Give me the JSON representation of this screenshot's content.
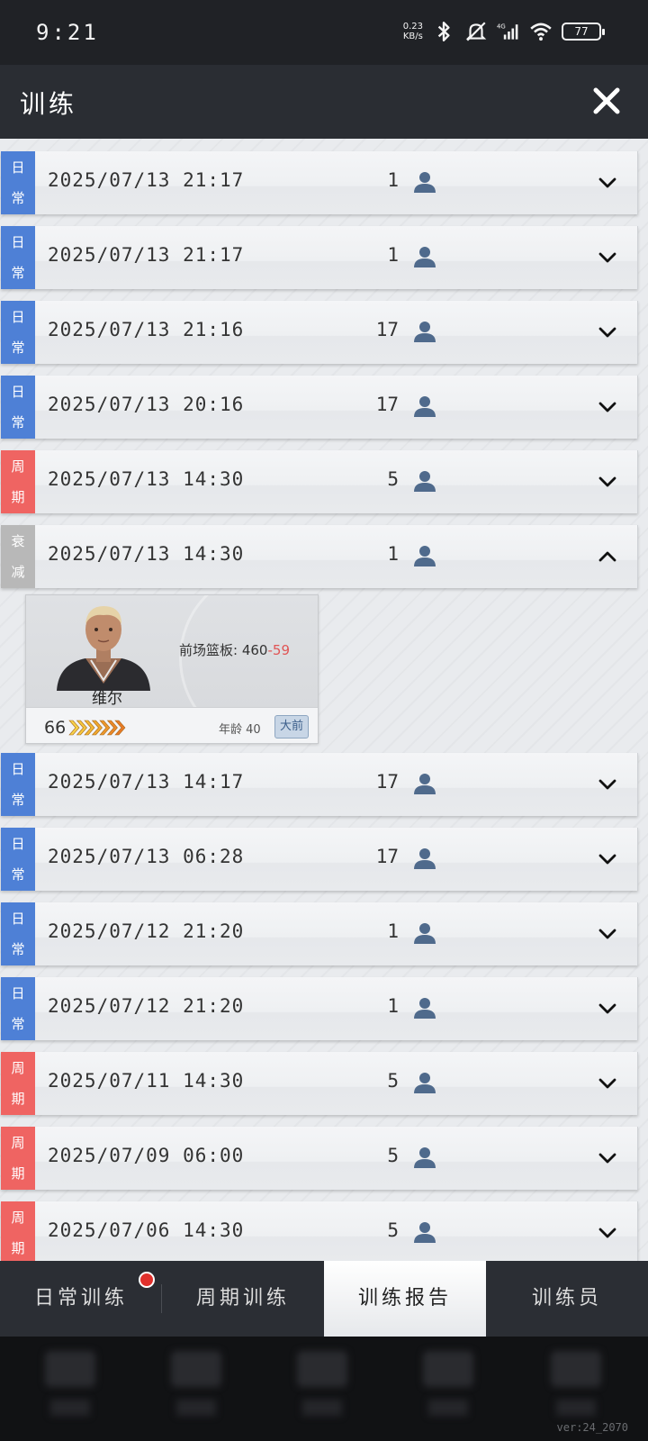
{
  "status_bar": {
    "time": "9:21",
    "net_speed": "0.23",
    "net_unit": "KB/s",
    "signal_label": "4G",
    "battery": "77"
  },
  "header": {
    "title": "训练"
  },
  "tags": {
    "daily": [
      "日",
      "常"
    ],
    "weekly": [
      "周",
      "期"
    ],
    "decline": [
      "衰",
      "减"
    ]
  },
  "rows": [
    {
      "type": "daily",
      "date": "2025/07/13 21:17",
      "count": "1",
      "expanded": false
    },
    {
      "type": "daily",
      "date": "2025/07/13 21:17",
      "count": "1",
      "expanded": false
    },
    {
      "type": "daily",
      "date": "2025/07/13 21:16",
      "count": "17",
      "expanded": false
    },
    {
      "type": "daily",
      "date": "2025/07/13 20:16",
      "count": "17",
      "expanded": false
    },
    {
      "type": "weekly",
      "date": "2025/07/13 14:30",
      "count": "5",
      "expanded": false
    },
    {
      "type": "decline",
      "date": "2025/07/13 14:30",
      "count": "1",
      "expanded": true
    },
    {
      "type": "daily",
      "date": "2025/07/13 14:17",
      "count": "17",
      "expanded": false
    },
    {
      "type": "daily",
      "date": "2025/07/13 06:28",
      "count": "17",
      "expanded": false
    },
    {
      "type": "daily",
      "date": "2025/07/12 21:20",
      "count": "1",
      "expanded": false
    },
    {
      "type": "daily",
      "date": "2025/07/12 21:20",
      "count": "1",
      "expanded": false
    },
    {
      "type": "weekly",
      "date": "2025/07/11 14:30",
      "count": "5",
      "expanded": false
    },
    {
      "type": "weekly",
      "date": "2025/07/09 06:00",
      "count": "5",
      "expanded": false
    },
    {
      "type": "weekly",
      "date": "2025/07/06 14:30",
      "count": "5",
      "expanded": false
    }
  ],
  "player_card": {
    "name": "维尔",
    "stat_label": "前场篮板:",
    "stat_value": "460",
    "stat_change": "-59",
    "rating": "66",
    "age_label": "年龄 40",
    "position": "大前"
  },
  "tabs": [
    {
      "label": "日常训练",
      "active": false,
      "badge": true
    },
    {
      "label": "周期训练",
      "active": false,
      "badge": false
    },
    {
      "label": "训练报告",
      "active": true,
      "badge": false
    },
    {
      "label": "训练员",
      "active": false,
      "badge": false
    }
  ],
  "version": "ver:24_2070",
  "colors": {
    "daily": "#4e80d6",
    "weekly": "#ef6462",
    "decline": "#b8b8b8",
    "badge": "#e0302c",
    "stat_change": "#e05555"
  }
}
